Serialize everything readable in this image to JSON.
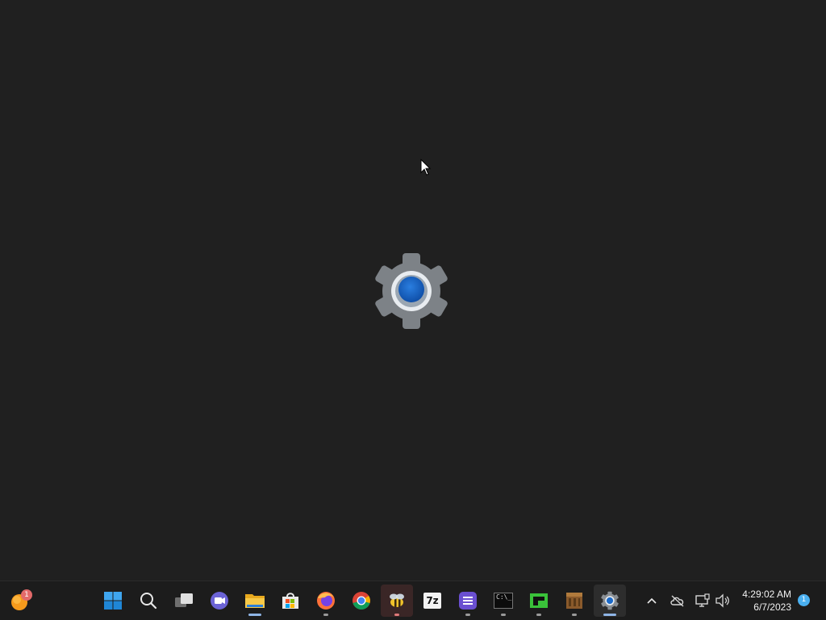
{
  "desktop": {
    "splash_icon": "settings-gear-icon",
    "accent": "#1b6ac9"
  },
  "taskbar": {
    "widgets": {
      "icon": "weather-widget-icon",
      "badge": "1"
    },
    "pinned": [
      {
        "name": "start",
        "icon": "windows-start-icon"
      },
      {
        "name": "search",
        "icon": "search-icon"
      },
      {
        "name": "task-view",
        "icon": "task-view-icon"
      },
      {
        "name": "chat",
        "icon": "teams-chat-icon"
      },
      {
        "name": "file-explorer",
        "icon": "folder-icon"
      },
      {
        "name": "microsoft-store",
        "icon": "store-icon"
      },
      {
        "name": "firefox",
        "icon": "firefox-icon"
      },
      {
        "name": "chrome",
        "icon": "chrome-icon"
      },
      {
        "name": "bee-app",
        "icon": "bee-icon"
      },
      {
        "name": "7zip",
        "icon": "7zip-icon",
        "label": "7z"
      },
      {
        "name": "notes-app",
        "icon": "notes-icon"
      },
      {
        "name": "command-prompt",
        "icon": "terminal-icon",
        "label": "C:\\_"
      },
      {
        "name": "green-app",
        "icon": "green-window-icon"
      },
      {
        "name": "minecraft",
        "icon": "crafting-table-icon"
      },
      {
        "name": "settings",
        "icon": "settings-gear-icon"
      }
    ]
  },
  "tray": {
    "icons": [
      "chevron-up-icon",
      "cloud-offline-icon",
      "network-icon",
      "volume-icon"
    ],
    "time": "4:29:02 AM",
    "date": "6/7/2023",
    "notification_count": "1"
  }
}
